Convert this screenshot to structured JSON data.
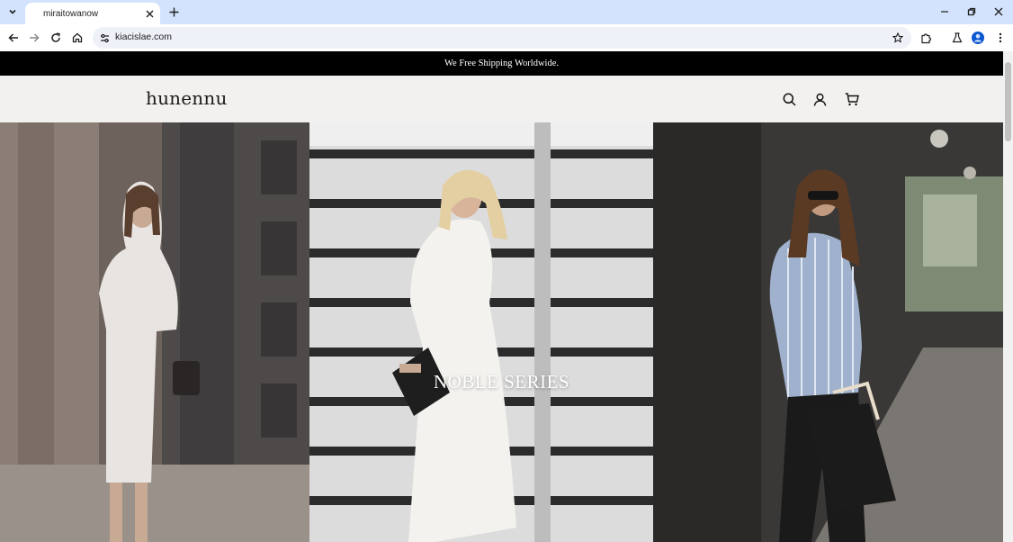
{
  "browser": {
    "tab_title": "miraitowanow",
    "url": "kiacislae.com"
  },
  "site": {
    "announcement": "We Free Shipping Worldwide.",
    "logo": "hunennu",
    "hero": {
      "title": "NOBLE SERIES"
    }
  },
  "icons": {
    "tab_list": "chevron-down-icon",
    "tab_close": "close-icon",
    "new_tab": "plus-icon",
    "minimize": "minimize-icon",
    "restore": "restore-icon",
    "close_window": "close-icon",
    "back": "arrow-left-icon",
    "forward": "arrow-right-icon",
    "reload": "reload-icon",
    "home": "home-icon",
    "site_info": "tune-icon",
    "bookmark": "star-icon",
    "extensions": "puzzle-icon",
    "labs": "flask-icon",
    "profile": "person-icon",
    "menu": "kebab-icon",
    "search": "search-icon",
    "account": "user-icon",
    "cart": "cart-icon"
  }
}
